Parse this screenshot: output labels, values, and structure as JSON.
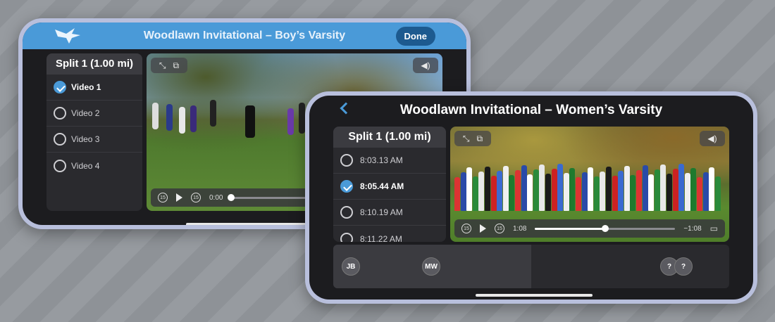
{
  "phone1": {
    "title": "Woodlawn Invitational – Boy’s Varsity",
    "done_label": "Done",
    "split_title": "Split 1 (1.00 mi)",
    "items": [
      {
        "label": "Video 1",
        "checked": true
      },
      {
        "label": "Video 2",
        "checked": false
      },
      {
        "label": "Video 3",
        "checked": false
      },
      {
        "label": "Video 4",
        "checked": false
      }
    ],
    "time": "0:00",
    "progress": 0.0
  },
  "phone2": {
    "title": "Woodlawn Invitational – Women’s Varsity",
    "split_title": "Split 1 (1.00 mi)",
    "items": [
      {
        "label": "8:03.13 AM",
        "checked": false
      },
      {
        "label": "8:05.44 AM",
        "checked": true
      },
      {
        "label": "8:10.19 AM",
        "checked": false
      },
      {
        "label": "8:11.22 AM",
        "checked": false
      }
    ],
    "time_elapsed": "1:08",
    "time_remaining": "−1:08",
    "progress": 0.5,
    "athletes": [
      {
        "initials": "JB"
      },
      {
        "initials": "MW"
      },
      {
        "initials": "?"
      },
      {
        "initials": "?"
      }
    ]
  },
  "colors": {
    "accent": "#4a9ad8",
    "header": "#4a9ad8",
    "done_button": "#1d5a8f"
  },
  "icons": [
    "bird-logo-icon",
    "expand-icon",
    "picture-in-picture-icon",
    "volume-icon",
    "skip-back-icon",
    "play-icon",
    "skip-forward-icon",
    "airplay-icon",
    "back-chevron-icon"
  ]
}
